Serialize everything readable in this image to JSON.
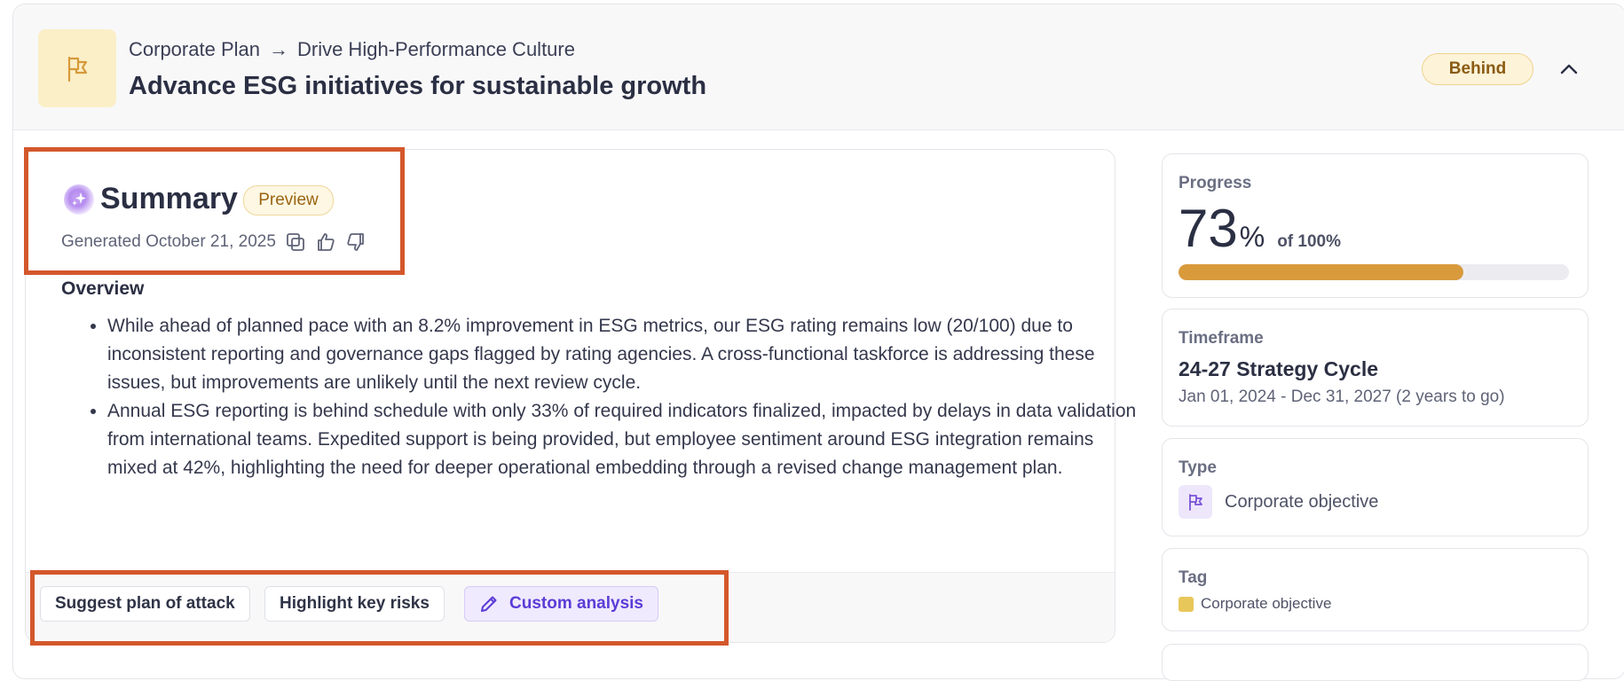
{
  "header": {
    "breadcrumb_parent": "Corporate Plan",
    "breadcrumb_child": "Drive High-Performance Culture",
    "title": "Advance ESG initiatives for sustainable growth",
    "status": "Behind"
  },
  "summary": {
    "title": "Summary",
    "badge": "Preview",
    "generated": "Generated October 21, 2025",
    "overview_heading": "Overview",
    "bullets": [
      "While ahead of planned pace with an 8.2% improvement in ESG metrics, our ESG rating remains low (20/100) due to inconsistent reporting and governance gaps flagged by rating agencies. A cross-functional taskforce is addressing these issues, but improvements are unlikely until the next review cycle.",
      "Annual ESG reporting is behind schedule with only 33% of required indicators finalized, impacted by delays in data validation from international teams. Expedited support is being provided, but employee sentiment around ESG integration remains mixed at 42%, highlighting the need for deeper operational embedding through a revised change management plan."
    ],
    "actions": {
      "suggest": "Suggest plan of attack",
      "risks": "Highlight key risks",
      "custom": "Custom analysis"
    }
  },
  "sidebar": {
    "progress": {
      "label": "Progress",
      "value": "73",
      "unit": "%",
      "of_text": "of 100%",
      "fraction": 0.73
    },
    "timeframe": {
      "label": "Timeframe",
      "name": "24-27 Strategy Cycle",
      "range": "Jan 01, 2024 - Dec 31, 2027 (2 years to go)"
    },
    "type": {
      "label": "Type",
      "value": "Corporate objective",
      "icon": "flag-icon"
    },
    "tag": {
      "label": "Tag",
      "value": "Corporate objective",
      "color": "#e8c75a"
    }
  },
  "colors": {
    "accent": "#d99a3c",
    "highlight": "#d4572b",
    "ai_purple": "#5a3cd6"
  }
}
